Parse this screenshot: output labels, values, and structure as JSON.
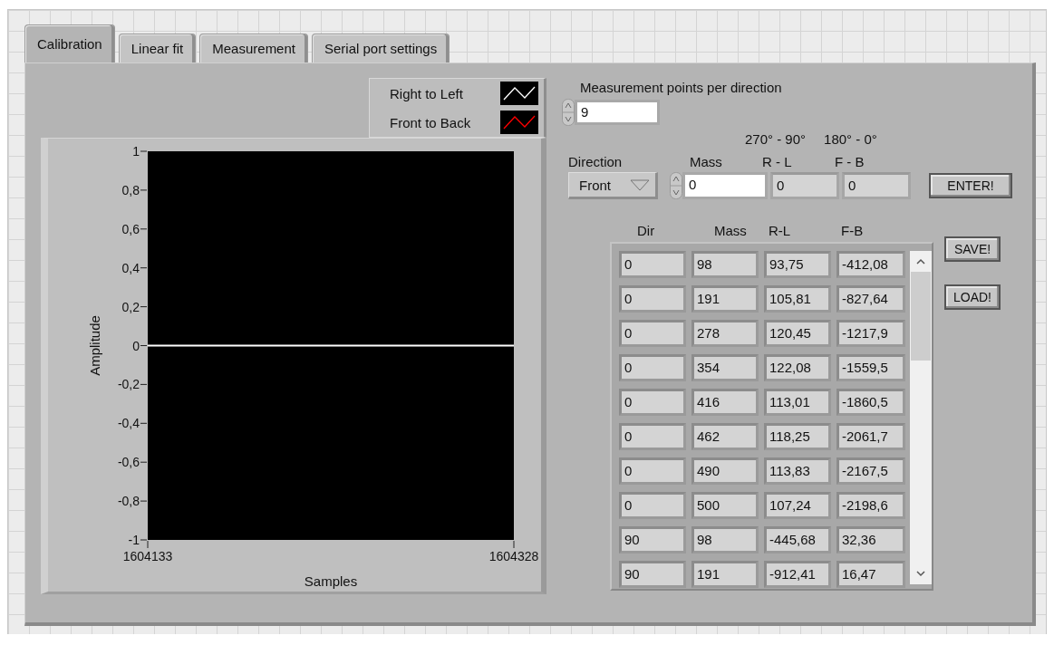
{
  "tabs": [
    {
      "label": "Calibration",
      "selected": true
    },
    {
      "label": "Linear fit",
      "selected": false
    },
    {
      "label": "Measurement",
      "selected": false
    },
    {
      "label": "Serial port settings",
      "selected": false
    }
  ],
  "graph": {
    "chart_data": {
      "type": "line",
      "xlabel": "Samples",
      "ylabel": "Amplitude",
      "x": [
        1604133,
        1604328
      ],
      "series": [
        {
          "name": "Right to Left",
          "color": "#ffffff",
          "values": [
            0,
            0
          ]
        },
        {
          "name": "Front to Back",
          "color": "#ff0000",
          "values": [
            null,
            null
          ]
        }
      ],
      "xlim": [
        1604133,
        1604328
      ],
      "ylim": [
        -1,
        1
      ],
      "xticks": [
        {
          "value": 1604133,
          "label": "1604133"
        },
        {
          "value": 1604328,
          "label": "1604328"
        }
      ],
      "yticks": [
        {
          "value": 1,
          "label": "1"
        },
        {
          "value": 0.8,
          "label": "0,8"
        },
        {
          "value": 0.6,
          "label": "0,6"
        },
        {
          "value": 0.4,
          "label": "0,4"
        },
        {
          "value": 0.2,
          "label": "0,2"
        },
        {
          "value": 0,
          "label": "0"
        },
        {
          "value": -0.2,
          "label": "-0,2"
        },
        {
          "value": -0.4,
          "label": "-0,4"
        },
        {
          "value": -0.6,
          "label": "-0,6"
        },
        {
          "value": -0.8,
          "label": "-0,8"
        },
        {
          "value": -1,
          "label": "-1"
        }
      ]
    }
  },
  "points_per_direction": {
    "label": "Measurement points per direction",
    "value": "9"
  },
  "angle_labels": [
    "270° - 90°",
    "180° - 0°"
  ],
  "entry": {
    "direction": {
      "label": "Direction",
      "value": "Front"
    },
    "mass": {
      "label": "Mass",
      "value": "0"
    },
    "rl": {
      "label": "R - L",
      "value": "0"
    },
    "fb": {
      "label": "F - B",
      "value": "0"
    }
  },
  "enter_button": "ENTER!",
  "table": {
    "columns": [
      "Dir",
      "Mass",
      "R-L",
      "F-B"
    ],
    "rows": [
      [
        "0",
        "98",
        "93,75",
        "-412,08"
      ],
      [
        "0",
        "191",
        "105,81",
        "-827,64"
      ],
      [
        "0",
        "278",
        "120,45",
        "-1217,9"
      ],
      [
        "0",
        "354",
        "122,08",
        "-1559,5"
      ],
      [
        "0",
        "416",
        "113,01",
        "-1860,5"
      ],
      [
        "0",
        "462",
        "118,25",
        "-2061,7"
      ],
      [
        "0",
        "490",
        "113,83",
        "-2167,5"
      ],
      [
        "0",
        "500",
        "107,24",
        "-2198,6"
      ],
      [
        "90",
        "98",
        "-445,68",
        "32,36"
      ],
      [
        "90",
        "191",
        "-912,41",
        "16,47"
      ]
    ]
  },
  "buttons": [
    "SAVE!",
    "LOAD!"
  ]
}
